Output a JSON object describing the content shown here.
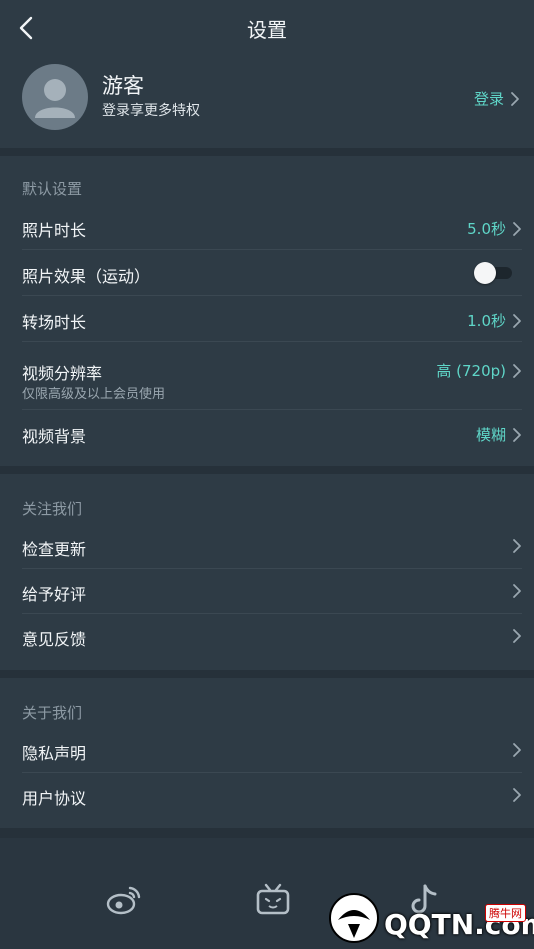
{
  "header": {
    "title": "设置"
  },
  "profile": {
    "name": "游客",
    "subtitle": "登录享更多特权",
    "login_label": "登录"
  },
  "sections": {
    "defaults": {
      "title": "默认设置",
      "photo_duration": {
        "label": "照片时长",
        "value": "5.0秒"
      },
      "photo_effect": {
        "label": "照片效果（运动）",
        "enabled": false
      },
      "transition_duration": {
        "label": "转场时长",
        "value": "1.0秒"
      },
      "video_resolution": {
        "label": "视频分辨率",
        "sub": "仅限高级及以上会员使用",
        "value": "高 (720p)"
      },
      "video_background": {
        "label": "视频背景",
        "value": "模糊"
      }
    },
    "follow": {
      "title": "关注我们",
      "check_update": {
        "label": "检查更新"
      },
      "give_rating": {
        "label": "给予好评"
      },
      "feedback": {
        "label": "意见反馈"
      }
    },
    "about": {
      "title": "关于我们",
      "privacy": {
        "label": "隐私声明"
      },
      "agreement": {
        "label": "用户协议"
      }
    }
  },
  "bottom_nav": {
    "icons": [
      "weibo-icon",
      "bilibili-icon",
      "douyin-icon"
    ]
  },
  "watermark": {
    "text": "QQTN.com",
    "badge": "腾牛网"
  },
  "colors": {
    "accent": "#5fd6c8",
    "background": "#2e3b45",
    "band": "#26313a"
  }
}
